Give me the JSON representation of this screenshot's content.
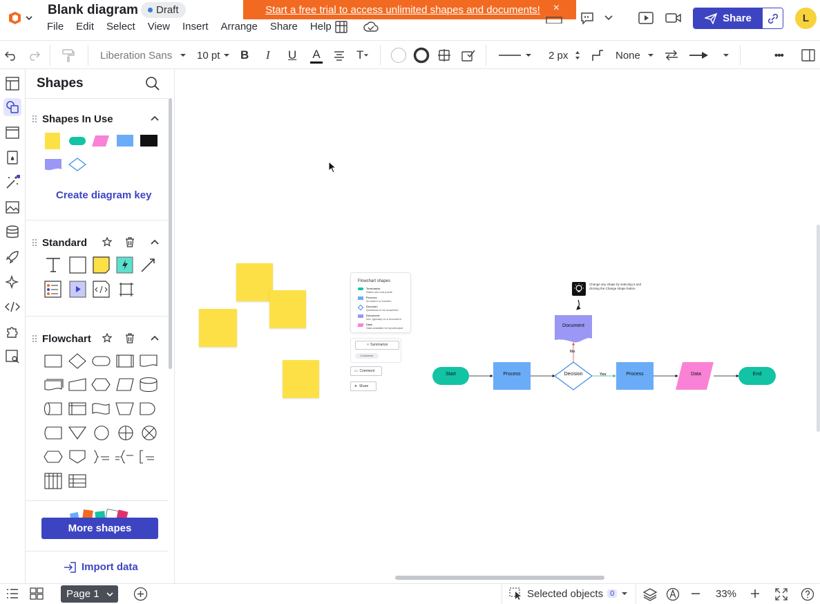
{
  "app": {
    "doc_title": "Blank diagram",
    "status_badge": "Draft",
    "menu": [
      "File",
      "Edit",
      "Select",
      "View",
      "Insert",
      "Arrange",
      "Share",
      "Help"
    ],
    "trial_banner": "Start a free trial to access unlimited shapes and documents!",
    "trial_close": "×",
    "share_label": "Share",
    "avatar_initial": "L"
  },
  "toolbar": {
    "font_family": "Liberation Sans",
    "font_size": "10 pt",
    "bold": "B",
    "italic": "I",
    "underline": "U",
    "text_color": "A",
    "text_options": "T",
    "line_width": "2 px",
    "endpoint_start": "None",
    "more": "•••"
  },
  "panel": {
    "title": "Shapes",
    "sections": {
      "in_use": "Shapes In Use",
      "standard": "Standard",
      "flowchart": "Flowchart"
    },
    "create_key": "Create diagram key",
    "more_shapes": "More shapes",
    "import_data": "Import data"
  },
  "canvas": {
    "card_title": "Flowchart shapes",
    "card_items": [
      {
        "label": "Terminator",
        "desc": "Starts and end points"
      },
      {
        "label": "Process",
        "desc": "An action or function"
      },
      {
        "label": "Decision",
        "desc": "Questions to be answered"
      },
      {
        "label": "Document",
        "desc": "Info, typically on a document"
      },
      {
        "label": "Data",
        "desc": "Data available for input/output"
      }
    ],
    "summarize": "Summarize",
    "customize": "Customize",
    "comment": "Comment",
    "share": "Share",
    "tip_text": "Change any shape by selecting it and clicking the Change shape button.",
    "nodes": {
      "start": "Start",
      "process1": "Process",
      "decision": "Decision",
      "process2": "Process",
      "data": "Data",
      "end": "End",
      "document": "Document",
      "yes": "Yes",
      "no": "No"
    }
  },
  "bottombar": {
    "page_label": "Page 1",
    "selected_objects": "Selected objects",
    "selected_count": "0",
    "zoom": "33%"
  },
  "colors": {
    "brand": "#3d44c2",
    "banner": "#f26a21",
    "yellow": "#fde046",
    "teal": "#12c3a4",
    "pink": "#f982d6",
    "blue": "#6aacf8",
    "purple": "#9a97f5"
  }
}
